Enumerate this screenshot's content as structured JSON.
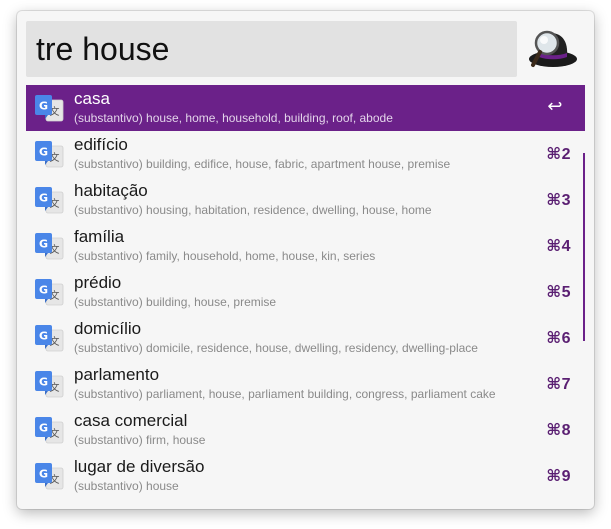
{
  "search": {
    "query": "tre house"
  },
  "results": [
    {
      "title": "casa",
      "subtitle": "(substantivo) house, home, household, building, roof, abode",
      "shortcut": "↩",
      "icon": "google-translate-icon",
      "selected": true
    },
    {
      "title": "edifício",
      "subtitle": "(substantivo) building, edifice, house, fabric, apartment house, premise",
      "shortcut": "⌘2",
      "icon": "google-translate-icon"
    },
    {
      "title": "habitação",
      "subtitle": "(substantivo) housing, habitation, residence, dwelling, house, home",
      "shortcut": "⌘3",
      "icon": "google-translate-icon"
    },
    {
      "title": "família",
      "subtitle": "(substantivo) family, household, home, house, kin, series",
      "shortcut": "⌘4",
      "icon": "google-translate-icon"
    },
    {
      "title": "prédio",
      "subtitle": "(substantivo) building, house, premise",
      "shortcut": "⌘5",
      "icon": "google-translate-icon"
    },
    {
      "title": "domicílio",
      "subtitle": "(substantivo) domicile, residence, house, dwelling, residency, dwelling-place",
      "shortcut": "⌘6",
      "icon": "google-translate-icon"
    },
    {
      "title": "parlamento",
      "subtitle": "(substantivo) parliament, house, parliament building, congress, parliament cake",
      "shortcut": "⌘7",
      "icon": "google-translate-icon"
    },
    {
      "title": "casa comercial",
      "subtitle": "(substantivo) firm, house",
      "shortcut": "⌘8",
      "icon": "google-translate-icon"
    },
    {
      "title": "lugar de diversão",
      "subtitle": "(substantivo) house",
      "shortcut": "⌘9",
      "icon": "google-translate-icon"
    }
  ],
  "colors": {
    "accent": "#6b2189",
    "shortcut": "#5a1f72",
    "search_background": "#e2e2e2",
    "window_background": "#f6f6f6"
  }
}
